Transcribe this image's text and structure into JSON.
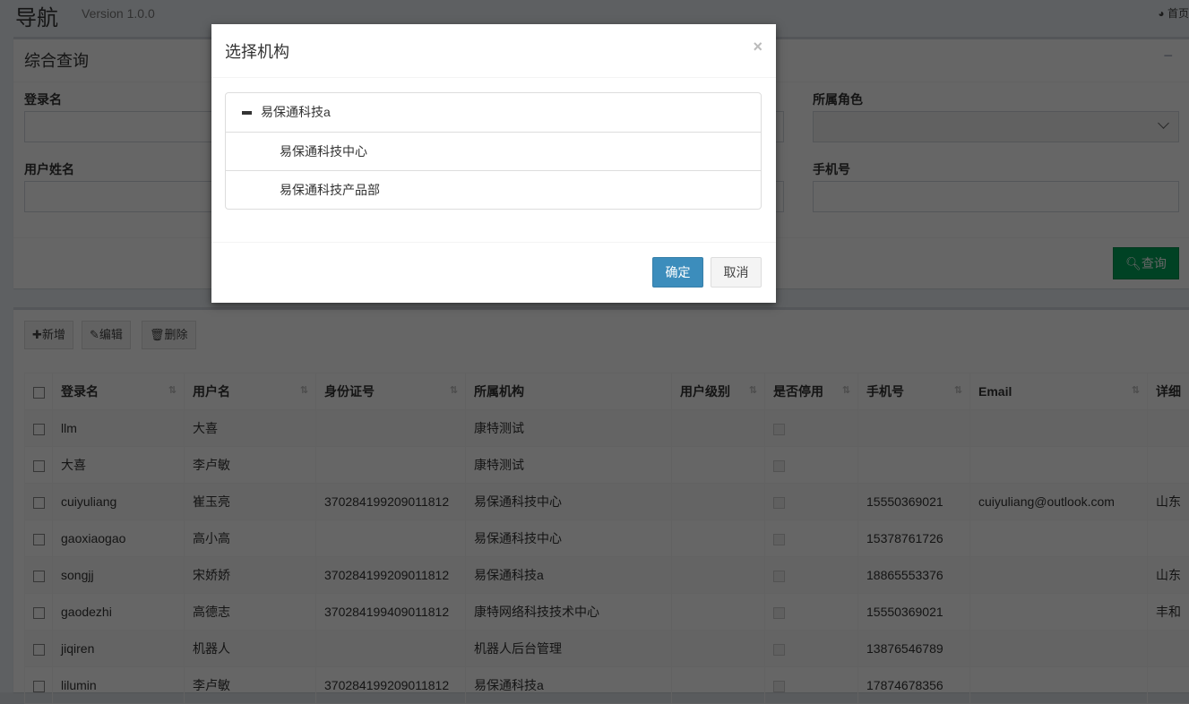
{
  "header": {
    "title": "导航",
    "version": "Version 1.0.0",
    "home": "首页"
  },
  "search": {
    "title": "综合查询",
    "fields": [
      {
        "label": "登录名"
      },
      {
        "label": "所属角色"
      },
      {
        "label": "用户姓名"
      },
      {
        "label": "手机号"
      }
    ],
    "query_button": "查询"
  },
  "toolbar": {
    "add": "新增",
    "edit": "编辑",
    "delete": "删除"
  },
  "table": {
    "columns": [
      "登录名",
      "用户名",
      "身份证号",
      "所属机构",
      "用户级别",
      "是否停用",
      "手机号",
      "Email",
      "详细"
    ],
    "rows": [
      [
        "llm",
        "大喜",
        "",
        "康特测试",
        "",
        "",
        "",
        ""
      ],
      [
        "大喜",
        "李卢敏",
        "",
        "康特测试",
        "",
        "",
        "",
        ""
      ],
      [
        "cuiyuliang",
        "崔玉亮",
        "370284199209011812",
        "易保通科技中心",
        "",
        "15550369021",
        "cuiyuliang@outlook.com",
        "山东"
      ],
      [
        "gaoxiaogao",
        "高小高",
        "",
        "易保通科技中心",
        "",
        "15378761726",
        "",
        ""
      ],
      [
        "songjj",
        "宋娇娇",
        "370284199209011812",
        "易保通科技a",
        "",
        "18865553376",
        "",
        "山东"
      ],
      [
        "gaodezhi",
        "高德志",
        "370284199409011812",
        "康特网络科技技术中心",
        "",
        "15550369021",
        "",
        "丰和"
      ],
      [
        "jiqiren",
        "机器人",
        "",
        "机器人后台管理",
        "",
        "13876546789",
        "",
        ""
      ],
      [
        "lilumin",
        "李卢敏",
        "370284199209011812",
        "易保通科技a",
        "",
        "17874678356",
        "",
        ""
      ]
    ]
  },
  "modal": {
    "title": "选择机构",
    "close": "×",
    "tree": [
      "易保通科技a",
      "易保通科技中心",
      "易保通科技产品部"
    ],
    "ok": "确定",
    "cancel": "取消"
  }
}
